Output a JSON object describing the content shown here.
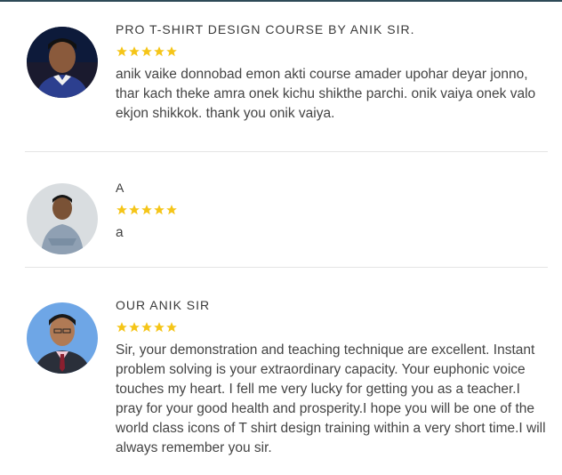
{
  "reviews": [
    {
      "title": "PRO T-SHIRT DESIGN COURSE BY ANIK SIR.",
      "rating": 5,
      "text": "anik vaike donnobad emon akti course amader upohar deyar jonno, thar kach theke amra onek kichu shikthe parchi. onik vaiya onek valo ekjon shikkok. thank you onik vaiya."
    },
    {
      "title": "A",
      "rating": 5,
      "text": "a"
    },
    {
      "title": "OUR ANIK SIR",
      "rating": 5,
      "text": "Sir, your demonstration and teaching technique are excellent. Instant problem solving is your extraordinary capacity. Your euphonic voice touches my heart. I fell me very lucky for getting you as a teacher.I pray for your good health and prosperity.I hope you will be one of the world class icons of T shirt design training within a very short time.I will always remember you sir."
    }
  ],
  "colors": {
    "star": "#f5c518",
    "divider": "#e5e5e5",
    "top_border": "#2e4a57",
    "title_text": "#3a3a3a",
    "body_text": "#444444"
  }
}
